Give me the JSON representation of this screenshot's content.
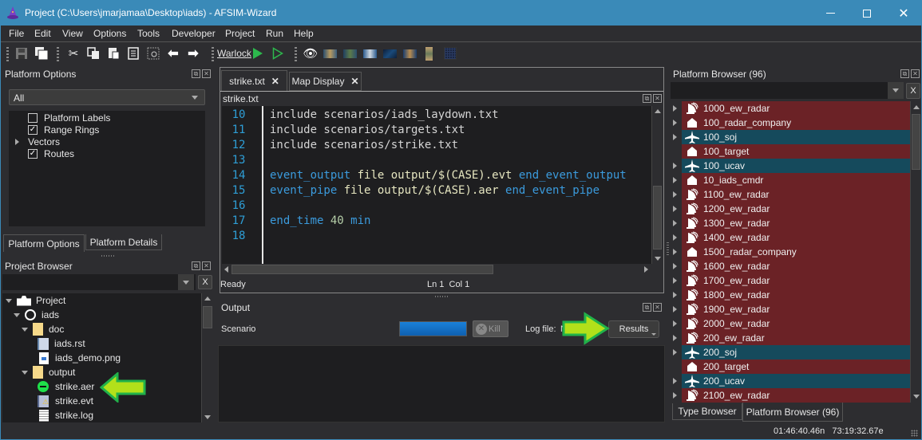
{
  "window": {
    "title": "Project (C:\\Users\\jmarjamaa\\Desktop\\iads) - AFSIM-Wizard",
    "controls": [
      "minimize-icon",
      "maximize-icon",
      "close-icon"
    ]
  },
  "menu": [
    "File",
    "Edit",
    "View",
    "Options",
    "Tools",
    "Developer",
    "Project",
    "Run",
    "Help"
  ],
  "toolbar": {
    "icons": [
      "save-icon",
      "save-all-icon",
      "cut-icon",
      "copy-icon",
      "paste-icon",
      "format-icon",
      "find-replace-icon",
      "back-arrow-icon",
      "forward-arrow-icon"
    ],
    "warlock_label": "Warlock",
    "run_icons": [
      "run-icon",
      "run-outline-icon"
    ],
    "map_icons": [
      "eye-icon",
      "map-layer-1-icon",
      "map-layer-2-icon",
      "map-layer-3-icon",
      "map-layer-4-icon",
      "map-layer-5-icon",
      "map-layer-6-icon",
      "grid-icon"
    ]
  },
  "platform_options": {
    "title": "Platform Options",
    "filter_value": "All",
    "items": [
      {
        "label": "Platform Labels",
        "checked": false,
        "type": "checkbox"
      },
      {
        "label": "Range Rings",
        "checked": true,
        "type": "checkbox"
      },
      {
        "label": "Vectors",
        "type": "expandable"
      },
      {
        "label": "Routes",
        "checked": true,
        "type": "checkbox"
      }
    ],
    "tabs": [
      "Platform Options",
      "Platform Details"
    ],
    "active_tab": "Platform Options"
  },
  "project_browser": {
    "title": "Project Browser",
    "filter_value": "",
    "clear_label": "X",
    "tree": [
      {
        "label": "Project",
        "icon": "project-icon",
        "level": 0,
        "expanded": true
      },
      {
        "label": "iads",
        "icon": "folder-circle-icon",
        "level": 1,
        "expanded": true
      },
      {
        "label": "doc",
        "icon": "folder-icon",
        "level": 2,
        "expanded": true
      },
      {
        "label": "iads.rst",
        "icon": "text-file-icon",
        "level": 3
      },
      {
        "label": "iads_demo.png",
        "icon": "image-file-icon",
        "level": 3
      },
      {
        "label": "output",
        "icon": "folder-icon",
        "level": 2,
        "expanded": true
      },
      {
        "label": "strike.aer",
        "icon": "aer-file-icon",
        "level": 3,
        "highlighted": true
      },
      {
        "label": "strike.evt",
        "icon": "evt-file-icon",
        "level": 3
      },
      {
        "label": "strike.log",
        "icon": "log-file-icon",
        "level": 3
      }
    ]
  },
  "editor": {
    "tabs": [
      {
        "label": "strike.txt",
        "active": true
      },
      {
        "label": "Map Display",
        "active": false
      }
    ],
    "doc_title": "strike.txt",
    "lines": [
      {
        "n": "10",
        "tokens": [
          {
            "t": "include scenarios/iads_laydown.txt",
            "c": "tx"
          }
        ]
      },
      {
        "n": "11",
        "tokens": [
          {
            "t": "include scenarios/targets.txt",
            "c": "tx"
          }
        ]
      },
      {
        "n": "12",
        "tokens": [
          {
            "t": "include scenarios/strike.txt",
            "c": "tx"
          }
        ]
      },
      {
        "n": "13",
        "tokens": []
      },
      {
        "n": "14",
        "tokens": [
          {
            "t": "event_output",
            "c": "kw"
          },
          {
            "t": " file output/$(CASE).evt ",
            "c": "st"
          },
          {
            "t": "end_event_output",
            "c": "kw"
          }
        ]
      },
      {
        "n": "15",
        "tokens": [
          {
            "t": "event_pipe",
            "c": "kw"
          },
          {
            "t": " file output/$(CASE).aer ",
            "c": "st"
          },
          {
            "t": "end_event_pipe",
            "c": "kw"
          }
        ]
      },
      {
        "n": "16",
        "tokens": []
      },
      {
        "n": "17",
        "tokens": [
          {
            "t": "end_time",
            "c": "kw"
          },
          {
            "t": " 40 ",
            "c": "nm"
          },
          {
            "t": "min",
            "c": "kw"
          }
        ]
      },
      {
        "n": "18",
        "tokens": []
      }
    ],
    "status_left": "Ready",
    "status_center": "Ln 1  Col 1"
  },
  "output": {
    "title": "Output",
    "scenario_label": "Scenario",
    "progress": 1.0,
    "kill_label": "Kill",
    "log_file_label": "Log file:",
    "log_file_value": "N",
    "results_label": "Results"
  },
  "platform_browser": {
    "title": "Platform Browser (96)",
    "filter_value": "",
    "clear_label": "X",
    "items": [
      {
        "label": "1000_ew_radar",
        "icon": "radar-icon",
        "side": "red",
        "expandable": true
      },
      {
        "label": "100_radar_company",
        "icon": "building-icon",
        "side": "red",
        "expandable": true
      },
      {
        "label": "100_soj",
        "icon": "aircraft-icon",
        "side": "blue",
        "expandable": true
      },
      {
        "label": "100_target",
        "icon": "building-icon",
        "side": "red",
        "expandable": false
      },
      {
        "label": "100_ucav",
        "icon": "aircraft-icon",
        "side": "blue",
        "expandable": true
      },
      {
        "label": "10_iads_cmdr",
        "icon": "building-icon",
        "side": "red",
        "expandable": true
      },
      {
        "label": "1100_ew_radar",
        "icon": "radar-icon",
        "side": "red",
        "expandable": true
      },
      {
        "label": "1200_ew_radar",
        "icon": "radar-icon",
        "side": "red",
        "expandable": true
      },
      {
        "label": "1300_ew_radar",
        "icon": "radar-icon",
        "side": "red",
        "expandable": true
      },
      {
        "label": "1400_ew_radar",
        "icon": "radar-icon",
        "side": "red",
        "expandable": true
      },
      {
        "label": "1500_radar_company",
        "icon": "building-icon",
        "side": "red",
        "expandable": true
      },
      {
        "label": "1600_ew_radar",
        "icon": "radar-icon",
        "side": "red",
        "expandable": true
      },
      {
        "label": "1700_ew_radar",
        "icon": "radar-icon",
        "side": "red",
        "expandable": true
      },
      {
        "label": "1800_ew_radar",
        "icon": "radar-icon",
        "side": "red",
        "expandable": true
      },
      {
        "label": "1900_ew_radar",
        "icon": "radar-icon",
        "side": "red",
        "expandable": true
      },
      {
        "label": "2000_ew_radar",
        "icon": "radar-icon",
        "side": "red",
        "expandable": true
      },
      {
        "label": "200_ew_radar",
        "icon": "radar-icon",
        "side": "red",
        "expandable": true
      },
      {
        "label": "200_soj",
        "icon": "aircraft-icon",
        "side": "blue",
        "expandable": true
      },
      {
        "label": "200_target",
        "icon": "building-icon",
        "side": "red",
        "expandable": false
      },
      {
        "label": "200_ucav",
        "icon": "aircraft-icon",
        "side": "blue",
        "expandable": true
      },
      {
        "label": "2100_ew_radar",
        "icon": "radar-icon",
        "side": "red",
        "expandable": true
      }
    ],
    "tabs": [
      "Type Browser",
      "Platform Browser (96)"
    ],
    "active_tab": "Platform Browser (96)"
  },
  "statusbar": {
    "coordinates": "01:46:40.46n   73:19:32.67e"
  },
  "colors": {
    "titlebar": "#3a8ab8",
    "red_side": "#6b2226",
    "blue_side": "#154a5c",
    "progress": "#1a73c8",
    "annotation_arrow": "#9be01a"
  }
}
